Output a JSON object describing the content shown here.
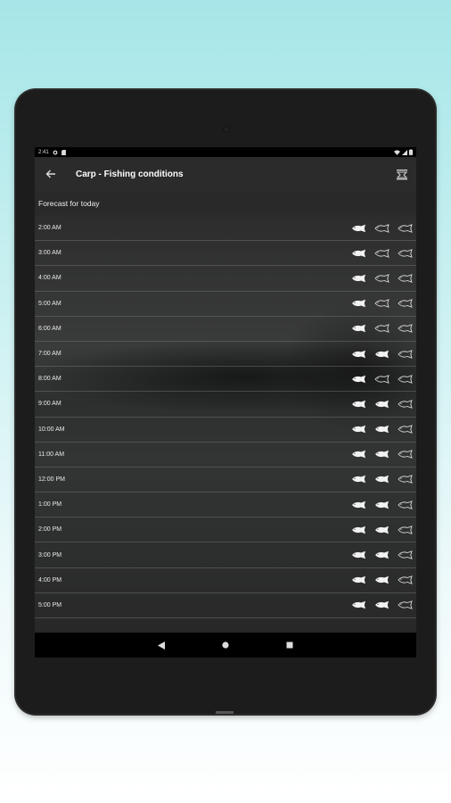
{
  "status_bar": {
    "time": "2:41"
  },
  "toolbar": {
    "title": "Carp - Fishing conditions"
  },
  "forecast": {
    "header": "Forecast for today",
    "rows": [
      {
        "time": "2:00 AM",
        "ratings": [
          true,
          false,
          false
        ]
      },
      {
        "time": "3:00 AM",
        "ratings": [
          true,
          false,
          false
        ]
      },
      {
        "time": "4:00 AM",
        "ratings": [
          true,
          false,
          false
        ]
      },
      {
        "time": "5:00 AM",
        "ratings": [
          true,
          false,
          false
        ]
      },
      {
        "time": "6:00 AM",
        "ratings": [
          true,
          false,
          false
        ]
      },
      {
        "time": "7:00 AM",
        "ratings": [
          true,
          true,
          false
        ]
      },
      {
        "time": "8:00 AM",
        "ratings": [
          true,
          false,
          false
        ]
      },
      {
        "time": "9:00 AM",
        "ratings": [
          true,
          true,
          false
        ]
      },
      {
        "time": "10:00 AM",
        "ratings": [
          true,
          true,
          false
        ]
      },
      {
        "time": "11:00 AM",
        "ratings": [
          true,
          true,
          false
        ]
      },
      {
        "time": "12:00 PM",
        "ratings": [
          true,
          true,
          false
        ]
      },
      {
        "time": "1:00 PM",
        "ratings": [
          true,
          true,
          false
        ]
      },
      {
        "time": "2:00 PM",
        "ratings": [
          true,
          true,
          false
        ]
      },
      {
        "time": "3:00 PM",
        "ratings": [
          true,
          true,
          false
        ]
      },
      {
        "time": "4:00 PM",
        "ratings": [
          true,
          true,
          false
        ]
      },
      {
        "time": "5:00 PM",
        "ratings": [
          true,
          true,
          false
        ]
      }
    ]
  },
  "icons": {
    "back": "arrow-left-icon",
    "menu": "layers-menu-icon",
    "fish_filled": "fish-filled-icon",
    "fish_outline": "fish-outline-icon",
    "nav_back": "triangle-back-icon",
    "nav_home": "circle-home-icon",
    "nav_recents": "square-recents-icon"
  },
  "colors": {
    "toolbar": "#2b2b2b",
    "background": "#111111",
    "text": "#eaeaea"
  }
}
